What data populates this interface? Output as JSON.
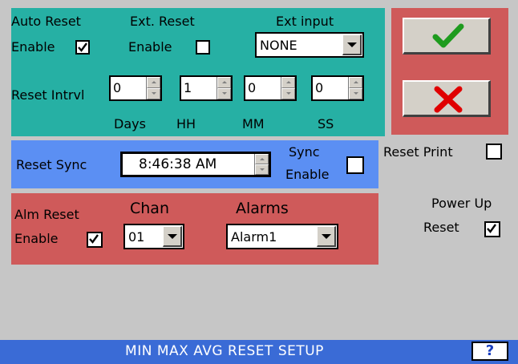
{
  "auto_reset": {
    "line1": "Auto Reset",
    "line2": "Enable",
    "checked": true
  },
  "ext_reset": {
    "line1": "Ext. Reset",
    "line2": "Enable",
    "checked": false
  },
  "ext_input": {
    "label": "Ext input",
    "value": "NONE"
  },
  "reset_interval": {
    "label": "Reset Intrvl",
    "days": "0",
    "hh": "1",
    "mm": "0",
    "ss": "0",
    "unit_days": "Days",
    "unit_hh": "HH",
    "unit_mm": "MM",
    "unit_ss": "SS"
  },
  "reset_sync": {
    "label": "Reset Sync",
    "time": "8:46:38 AM",
    "sync_line1": "Sync",
    "sync_line2": "Enable",
    "sync_checked": false
  },
  "reset_print": {
    "label": "Reset Print",
    "checked": false
  },
  "power_up": {
    "line1": "Power Up",
    "line2": "Reset",
    "checked": true
  },
  "alm_reset": {
    "line1": "Alm Reset",
    "line2": "Enable",
    "checked": true,
    "chan_label": "Chan",
    "chan_value": "01",
    "alarms_label": "Alarms",
    "alarms_value": "Alarm1"
  },
  "footer": {
    "title": "MIN MAX AVG RESET SETUP",
    "help": "?"
  },
  "colors": {
    "teal": "#26b0a4",
    "blue": "#5b8ff3",
    "red": "#cf5a5a",
    "footer": "#3a6bd6",
    "ok_green": "#1e9b1e",
    "cancel_red": "#e00000"
  }
}
